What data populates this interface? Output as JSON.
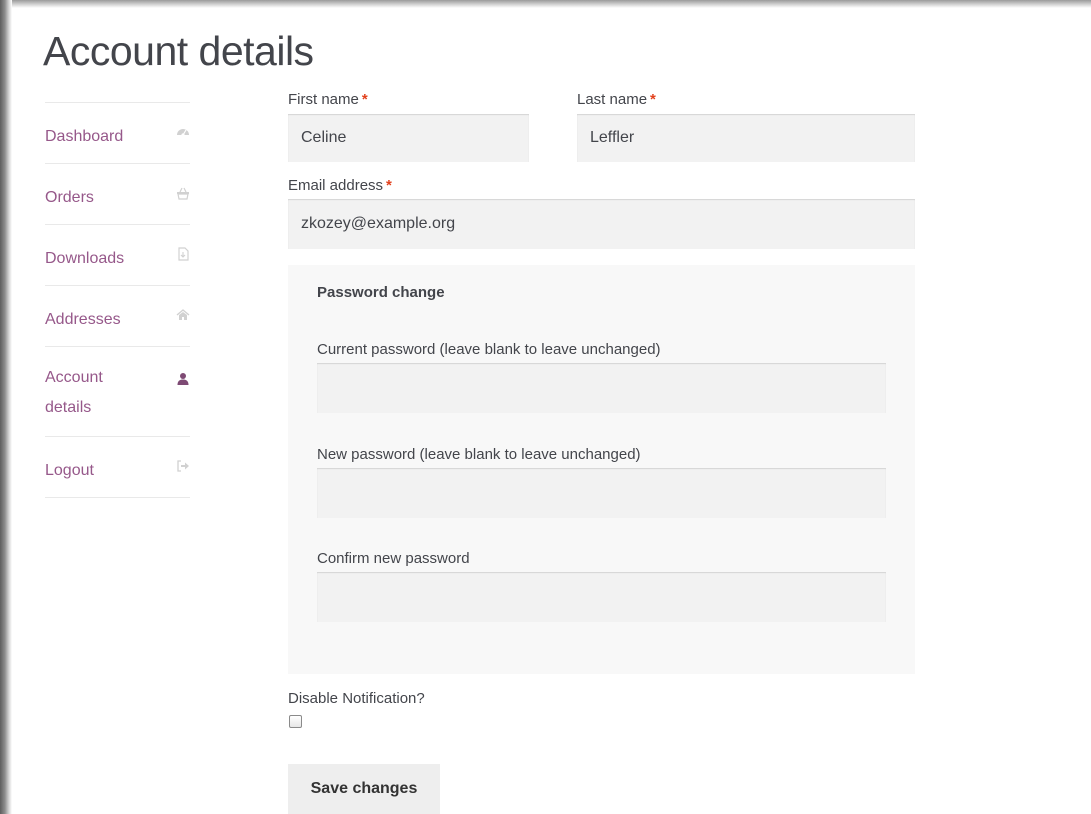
{
  "page": {
    "title": "Account details"
  },
  "nav": {
    "items": [
      {
        "label": "Dashboard",
        "icon": "dashboard-icon"
      },
      {
        "label": "Orders",
        "icon": "basket-icon"
      },
      {
        "label": "Downloads",
        "icon": "file-download-icon"
      },
      {
        "label": "Addresses",
        "icon": "home-icon"
      },
      {
        "label": "Account details",
        "icon": "user-icon",
        "active": true
      },
      {
        "label": "Logout",
        "icon": "sign-out-icon"
      }
    ]
  },
  "form": {
    "first_name": {
      "label": "First name",
      "required_mark": "*",
      "value": "Celine"
    },
    "last_name": {
      "label": "Last name",
      "required_mark": "*",
      "value": "Leffler"
    },
    "email": {
      "label": "Email address",
      "required_mark": "*",
      "value": "zkozey@example.org"
    },
    "password_change": {
      "legend": "Password change",
      "current": {
        "label": "Current password (leave blank to leave unchanged)",
        "value": ""
      },
      "new": {
        "label": "New password (leave blank to leave unchanged)",
        "value": ""
      },
      "confirm": {
        "label": "Confirm new password",
        "value": ""
      }
    },
    "disable_notification": {
      "label": "Disable Notification?",
      "checked": false
    },
    "save_label": "Save changes"
  },
  "colors": {
    "link": "#96588a",
    "active_icon": "#7e4a74",
    "required": "#e2401c",
    "input_bg": "#f2f2f2",
    "fieldset_bg": "#f8f8f8",
    "button_bg": "#eeeeee"
  }
}
